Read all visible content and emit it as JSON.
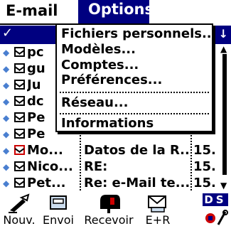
{
  "menubar": {
    "menus": [
      "E-mail",
      "Options"
    ]
  },
  "dropdown": {
    "items": [
      "Fichiers personnels...",
      "Modèles...",
      "Comptes...",
      "Préférences...",
      "Réseau...",
      "Informations"
    ]
  },
  "list": {
    "rows": [
      {
        "from": "pc",
        "subject": "",
        "date": ""
      },
      {
        "from": "gu",
        "subject": "",
        "date": ""
      },
      {
        "from": "Ju",
        "subject": "",
        "date": ""
      },
      {
        "from": "dc",
        "subject": "",
        "date": ""
      },
      {
        "from": "Pe",
        "subject": "",
        "date": ""
      },
      {
        "from": "Pe",
        "subject": "",
        "date": ""
      },
      {
        "from": "Mo...",
        "subject": "Datos de la R...",
        "date": "15..."
      },
      {
        "from": "Nico...",
        "subject": "RE:",
        "date": "15..."
      },
      {
        "from": "Pet...",
        "subject": "Re: e-Mail te...",
        "date": "15..."
      }
    ]
  },
  "toolbar": {
    "buttons": [
      "Nouv.",
      "Envoi",
      "Recevoir",
      "E+R"
    ],
    "ds_label": "DS"
  },
  "colors": {
    "accent": "#000080",
    "bullet": "#4a7fd0",
    "flag": "#cc0000"
  }
}
